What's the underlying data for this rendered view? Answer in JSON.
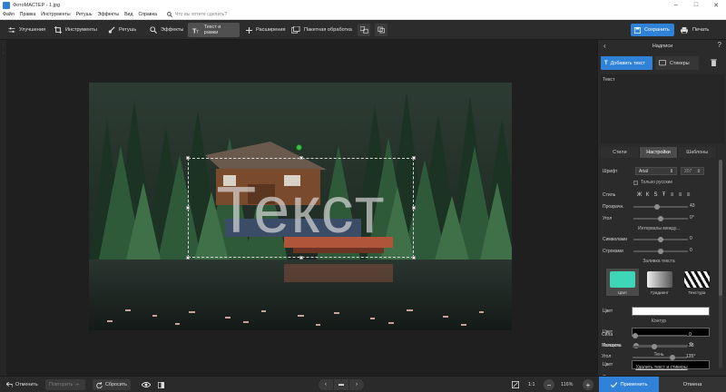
{
  "window": {
    "title": "ФотоМАСТЕР - 1.jpg"
  },
  "menu": {
    "items": [
      "Файл",
      "Правка",
      "Инструменты",
      "Ретушь",
      "Эффекты",
      "Вид",
      "Справка"
    ],
    "search_placeholder": "Что вы хотите сделать?"
  },
  "toolbar": {
    "tools": [
      {
        "label": "Улучшения",
        "icon": "sliders-icon"
      },
      {
        "label": "Инструменты",
        "icon": "crop-icon"
      },
      {
        "label": "Ретушь",
        "icon": "brush-icon"
      },
      {
        "label": "Эффекты",
        "icon": "wand-icon"
      },
      {
        "label": "Текст и рамки",
        "icon": "text-icon",
        "active": true
      },
      {
        "label": "Расширения",
        "icon": "plus-icon"
      },
      {
        "label": "Пакетная обработка",
        "icon": "batch-icon"
      }
    ],
    "save_label": "Сохранить",
    "print_label": "Печать"
  },
  "canvas": {
    "overlay_text": "Текст"
  },
  "bottom": {
    "undo_label": "Отменить",
    "redo_label": "Повторить",
    "reset_label": "Сбросить",
    "zoom_ratio": "1:1",
    "zoom_percent": "116%",
    "apply_label": "Применить",
    "cancel_label": "Отмена"
  },
  "panel": {
    "title": "Надписи",
    "add_text_label": "Добавить текст",
    "stickers_label": "Стикеры",
    "text_value": "Текст",
    "tabs": [
      "Стили",
      "Настройки",
      "Шаблоны"
    ],
    "active_tab": 1,
    "font_label": "Шрифт",
    "font_value": "Arial",
    "size_value": "207",
    "only_russian_label": "Только русские",
    "style_label": "Стиль",
    "style_buttons": [
      "Ж",
      "К",
      "S",
      "Ŧ",
      "≡",
      "≡",
      "≡"
    ],
    "transparency_label": "Прозрачн.",
    "transparency_value": "43",
    "angle_label": "Угол",
    "angle_value": "0°",
    "intervals_label": "Интервалы между...",
    "symbols_label": "Символами",
    "symbols_value": "0",
    "lines_label": "Строками",
    "lines_value": "0",
    "fill_label": "Заливка текста",
    "fill_tiles": [
      {
        "label": "Цвет",
        "color": "#3fd6b8"
      },
      {
        "label": "Градиент",
        "color": "#cfcfcf"
      },
      {
        "label": "Текстура",
        "color": "#ffffff"
      }
    ],
    "fill_color_label": "Цвет",
    "fill_color": "#ffffff",
    "outline_label": "Контур",
    "outline_color_label": "Цвет",
    "outline_color": "#000000",
    "thickness_label": "Толщина",
    "thickness_value": "0",
    "shadow_label": "Тень",
    "shadow_color_label": "Цвет",
    "shadow_color": "#000000",
    "strength_label": "Сила",
    "strength_value": "0",
    "softness_label": "Мягкость",
    "softness_value": "38",
    "shadow_angle_label": "Угол",
    "shadow_angle_value": "135°",
    "delete_link": "Удалить текст и стикеры",
    "levels": {
      "transparency": 0.43,
      "angle": 0.5,
      "symbols": 0.5,
      "lines": 0.5,
      "thickness": 0.0,
      "strength": 0.0,
      "softness": 0.38,
      "shadow_angle": 0.75
    }
  },
  "colors": {
    "accent": "#2f82d8"
  }
}
